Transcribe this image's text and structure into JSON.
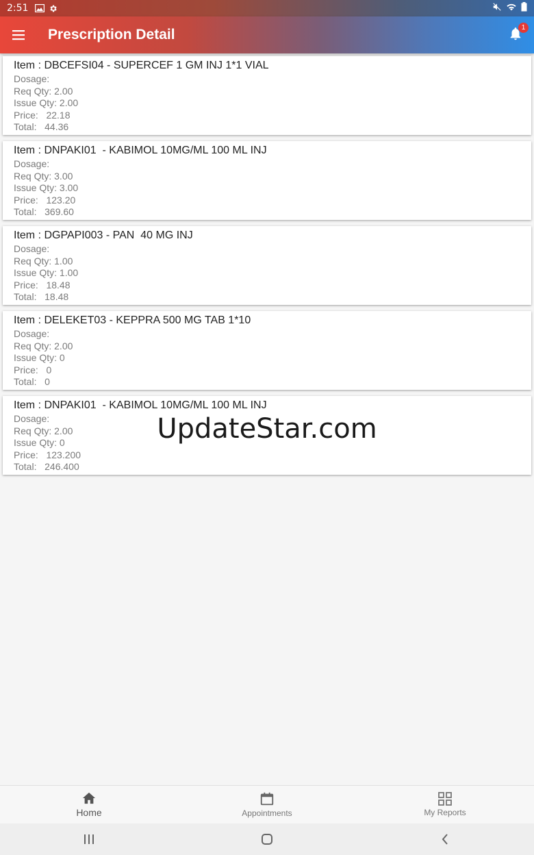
{
  "status_bar": {
    "time": "2:51"
  },
  "app_bar": {
    "title": "Prescription Detail",
    "notification_count": "1"
  },
  "labels": {
    "dosage": "Dosage:",
    "req_qty": "Req Qty:",
    "issue_qty": "Issue Qty:",
    "price": "Price:",
    "total": "Total:"
  },
  "items": [
    {
      "title": "Item : DBCEFSI04 - SUPERCEF 1 GM INJ 1*1 VIAL",
      "dosage": "",
      "req_qty": "2.00",
      "issue_qty": "2.00",
      "price": "22.18",
      "total": "44.36"
    },
    {
      "title": "Item : DNPAKI01  - KABIMOL 10MG/ML 100 ML INJ",
      "dosage": "",
      "req_qty": "3.00",
      "issue_qty": "3.00",
      "price": "123.20",
      "total": "369.60"
    },
    {
      "title": "Item : DGPAPI003 - PAN  40 MG INJ",
      "dosage": "",
      "req_qty": "1.00",
      "issue_qty": "1.00",
      "price": "18.48",
      "total": "18.48"
    },
    {
      "title": "Item : DELEKET03 - KEPPRA 500 MG TAB 1*10",
      "dosage": "",
      "req_qty": "2.00",
      "issue_qty": "0",
      "price": "0",
      "total": "0"
    },
    {
      "title": "Item : DNPAKI01  - KABIMOL 10MG/ML 100 ML INJ",
      "dosage": "",
      "req_qty": "2.00",
      "issue_qty": "0",
      "price": "123.200",
      "total": "246.400"
    }
  ],
  "watermark": "UpdateStar.com",
  "bottom_nav": [
    {
      "label": "Home",
      "icon": "home-icon"
    },
    {
      "label": "Appointments",
      "icon": "calendar-icon"
    },
    {
      "label": "My Reports",
      "icon": "grid-icon"
    }
  ],
  "colors": {
    "appbar_start": "#e8473a",
    "appbar_end": "#2f8ee6",
    "badge": "#e53935"
  }
}
